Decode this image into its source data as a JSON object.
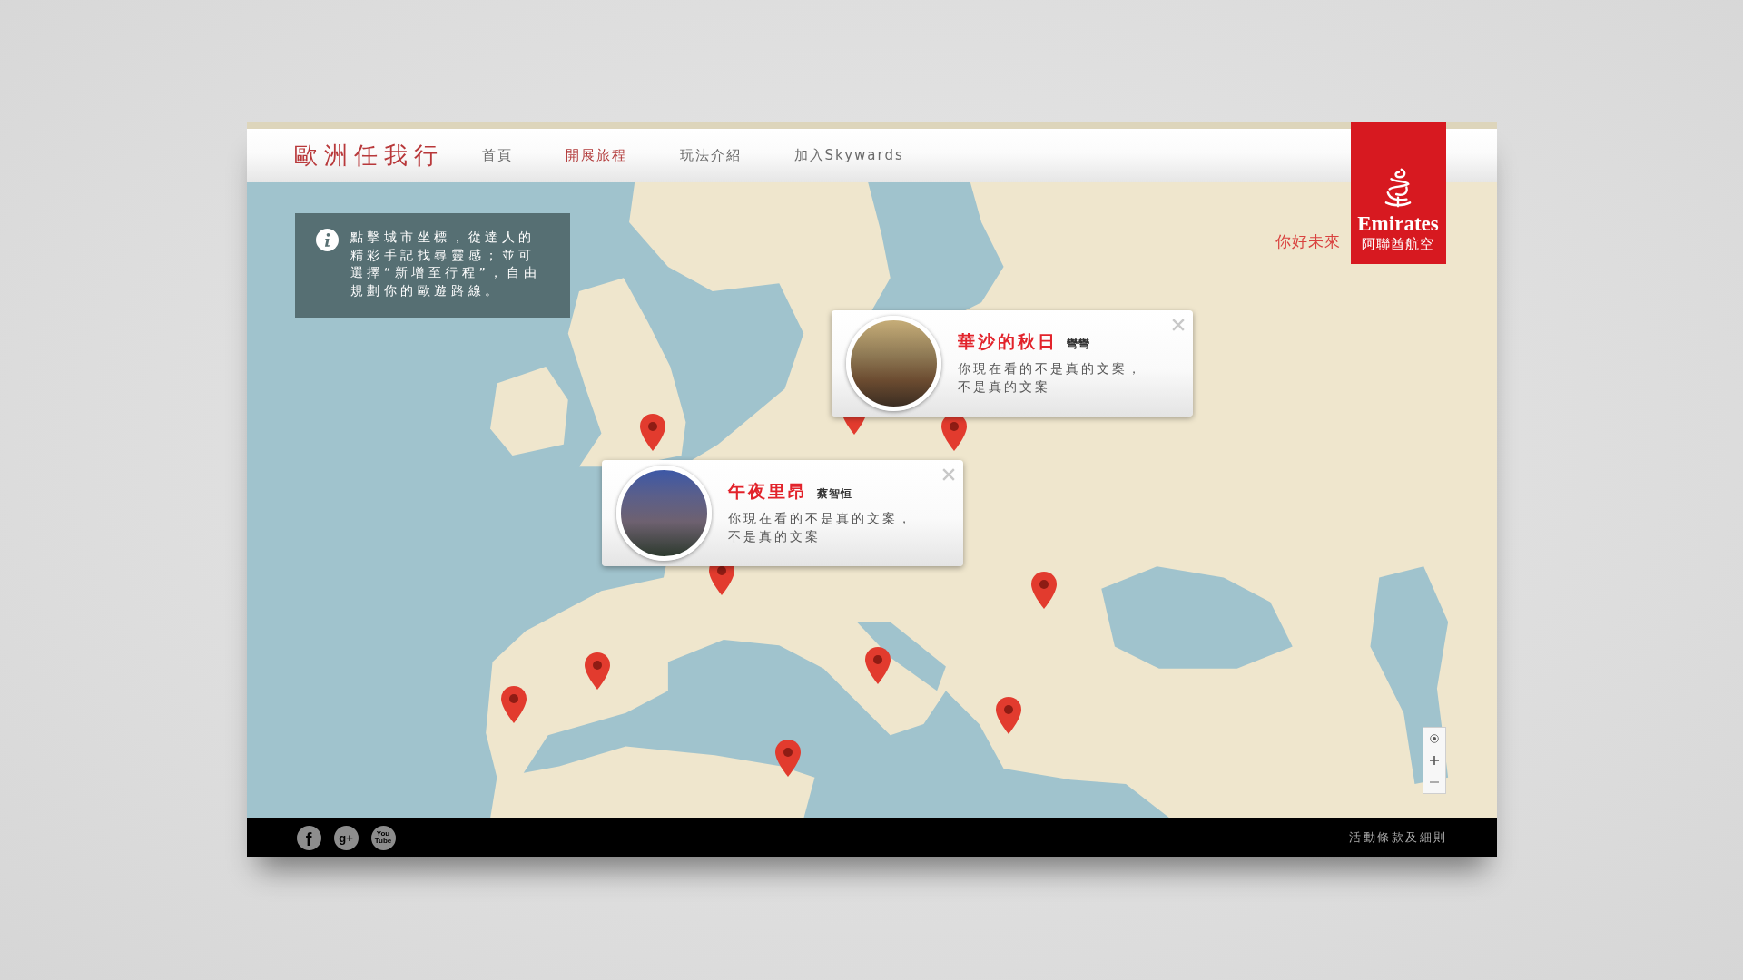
{
  "page": {
    "title": "歐洲任我行"
  },
  "nav": [
    {
      "label": "首頁",
      "selected": false
    },
    {
      "label": "開展旅程",
      "selected": true
    },
    {
      "label": "玩法介紹",
      "selected": false
    },
    {
      "label": "加入Skywards",
      "selected": false
    }
  ],
  "brand": {
    "slogan": "你好未來",
    "wordmark": "Emirates",
    "subtitle": "阿聯酋航空"
  },
  "info": {
    "text": "點擊城市坐標，從達人的精彩手記找尋靈感；並可選擇“新增至行程”，自由規劃你的歐遊路線。"
  },
  "popups": [
    {
      "title": "華沙的秋日",
      "author": "彎彎",
      "text": "你現在看的不是真的文案，不是真的文案"
    },
    {
      "title": "午夜里昂",
      "author": "蔡智恒",
      "text": "你現在看的不是真的文案，不是真的文案"
    }
  ],
  "footer": {
    "social": [
      {
        "kind": "facebook",
        "glyph": "f"
      },
      {
        "kind": "google-plus",
        "glyph": "g+"
      },
      {
        "kind": "youtube",
        "glyph": "You\nTube"
      }
    ],
    "terms": "活動條款及細則"
  }
}
